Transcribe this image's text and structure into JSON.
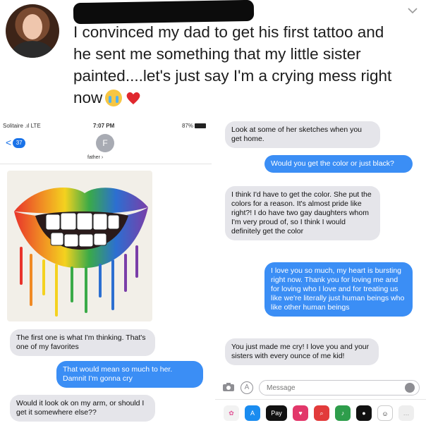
{
  "post": {
    "text": "I convinced my dad to get his first tattoo and he sent me something that my little sister painted....let's just say I'm a crying mess right now",
    "chevron": "chevron-down-icon"
  },
  "left_screen": {
    "status": {
      "carrier": "Solitaire .ıl LTE",
      "time": "7:07 PM",
      "battery": "87%"
    },
    "back_count": "37",
    "contact_initial": "F",
    "contact_name": "father",
    "messages": [
      {
        "from": "them",
        "text": "The first one is what I'm thinking. That's one of my favorites"
      },
      {
        "from": "me",
        "text": "That would mean so much to her. Damnit I'm gonna cry"
      },
      {
        "from": "them",
        "text": "Would it look ok on my arm, or should I get it somewhere else??"
      }
    ]
  },
  "right_screen": {
    "messages": [
      {
        "from": "them",
        "text": "Look at some of her sketches when you get home."
      },
      {
        "from": "me",
        "text": "Would you get the color or just black?"
      },
      {
        "from": "them",
        "text": "I think I'd have to get the color. She put the colors for a reason. It's almost pride like right?! I do have two gay daughters whom I'm very proud of, so I think I would definitely get the color"
      },
      {
        "from": "me",
        "text": "I love you so much, my heart is bursting right now. Thank you for loving me and for loving who I love and for treating us like we're literally just human beings who like other human beings"
      },
      {
        "from": "them",
        "text": "You just made me cry! I love you and your sisters with every ounce of me kid!"
      }
    ],
    "input_placeholder": "Message",
    "tray": {
      "applepay_label": "Pay"
    }
  },
  "colors": {
    "imessage_blue": "#3b8ef5",
    "received_gray": "#e5e5ea"
  }
}
